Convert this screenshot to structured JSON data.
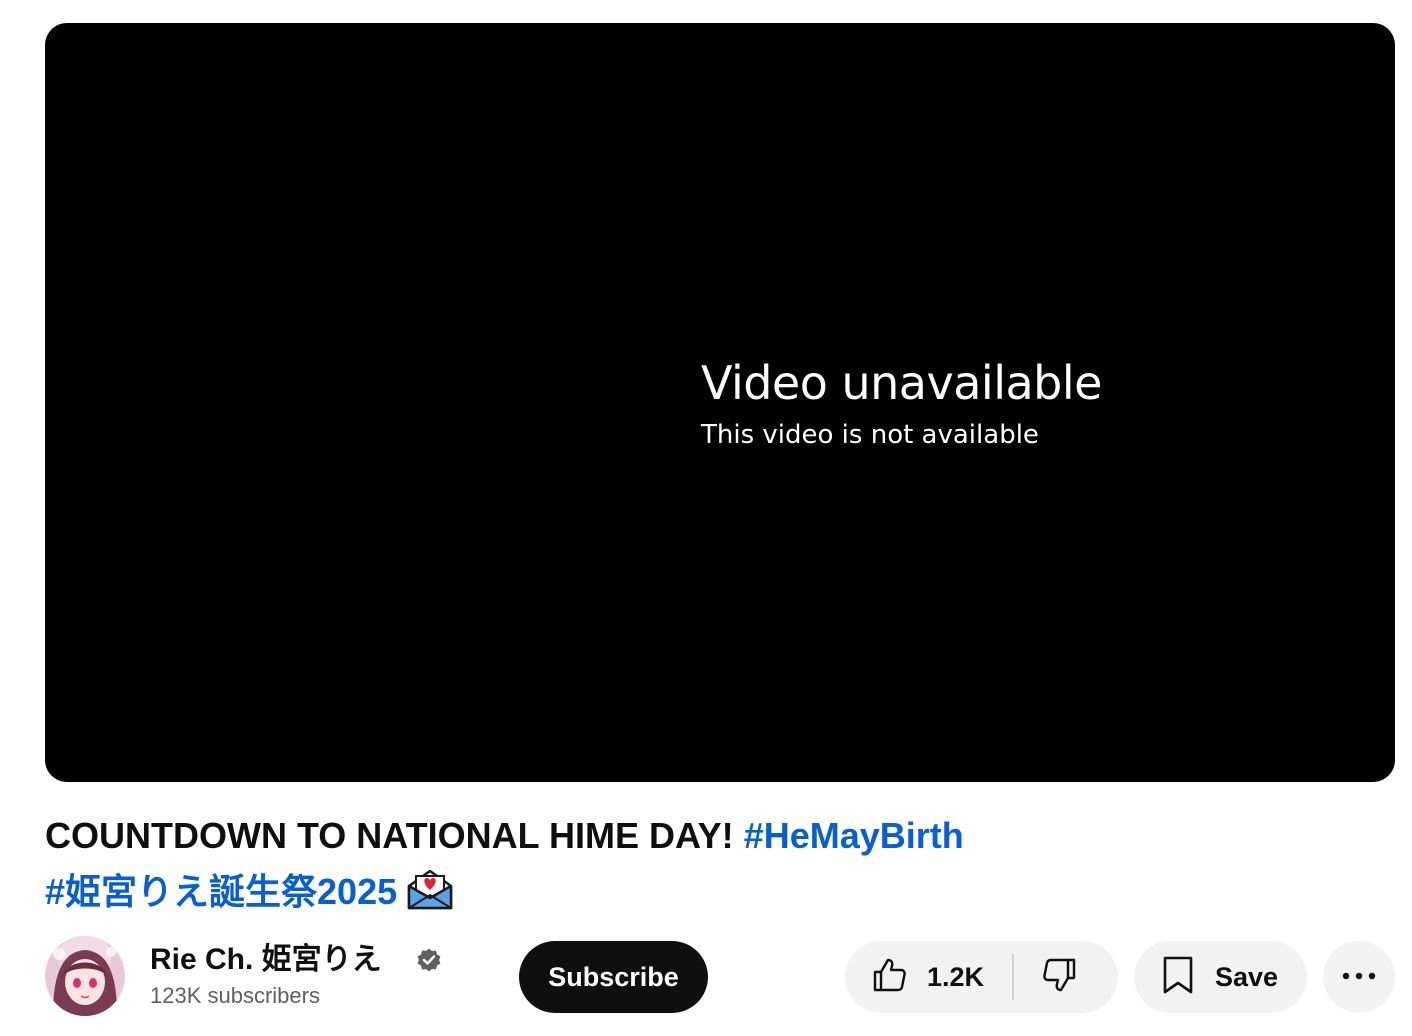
{
  "player": {
    "error_title": "Video unavailable",
    "error_subtitle": "This video is not available"
  },
  "video": {
    "title_text": "COUNTDOWN TO NATIONAL HIME DAY!",
    "hashtag_1": "#HeMayBirth",
    "hashtag_2": "#姫宮りえ誕生祭2025",
    "title_emoji_icon": "envelope-with-heart-icon"
  },
  "channel": {
    "name": "Rie Ch. 姫宮りえ",
    "subscribers": "123K subscribers",
    "verified_icon": "verified-badge-icon"
  },
  "actions": {
    "subscribe_label": "Subscribe",
    "like_count": "1.2K",
    "save_label": "Save"
  },
  "colors": {
    "hashtag": "#065fd4",
    "subscribe_bg": "#0f0f0f",
    "pill_bg": "#f2f2f2"
  }
}
